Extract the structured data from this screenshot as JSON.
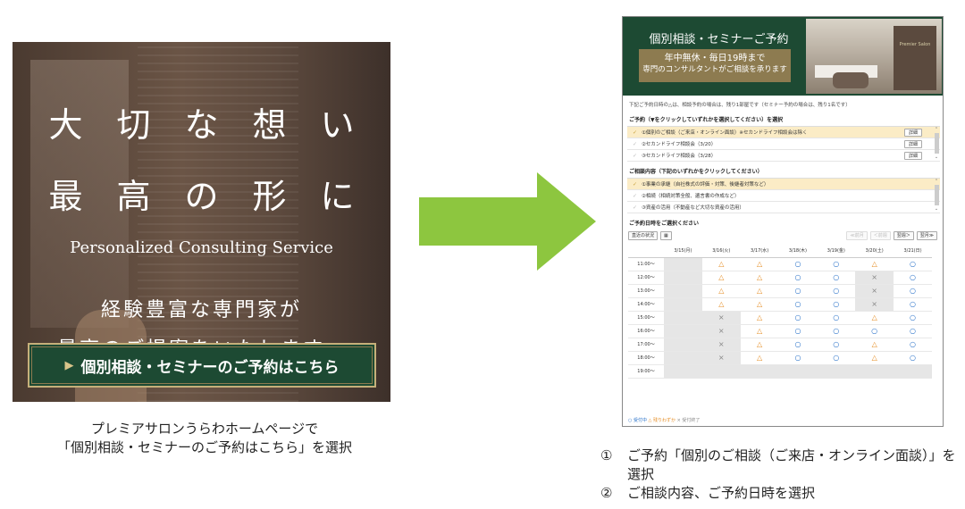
{
  "banner": {
    "headline1": "大切な想い",
    "headline2": "最高の形に",
    "subtitle_en": "Personalized Consulting Service",
    "copy1": "経験豊富な専門家が",
    "copy2": "最高のご提案をいたします。",
    "cta_label": "個別相談・セミナーのご予約はこちら",
    "cta_icon": "play-triangle-icon"
  },
  "caption_left": {
    "line1": "プレミアサロンうらわホームページで",
    "line2": "「個別相談・セミナーのご予約はこちら」を選択"
  },
  "arrow_color": "#8dc63f",
  "reservation": {
    "title": "個別相談・セミナーご予約",
    "badge_line1": "年中無休・毎日19時まで",
    "badge_line2": "専門のコンサルタントがご相談を承ります",
    "photo_sign": "Premier Salon",
    "note": "下記ご予約日時の△は、相談予約の場合は、残り1部屋です（セミナー予約の場合は、残り1名です）",
    "section1_title": "ご予約（▼をクリックしていずれかを選択してください）を選択",
    "section1_items": [
      {
        "label": "①個別のご相談（ご来店・オンライン面談）※セカンドライフ相談会は除く",
        "detail": "詳細",
        "selected": true
      },
      {
        "label": "②セカンドライフ相談会（3/20）",
        "detail": "詳細",
        "selected": false
      },
      {
        "label": "③セカンドライフ相談会（3/28）",
        "detail": "詳細",
        "selected": false
      }
    ],
    "section2_title": "ご相談内容（下記のいずれかをクリックしてください）",
    "section2_items": [
      {
        "label": "①事業の承継（自社株式の評価・対策、後継者対策など）",
        "selected": true
      },
      {
        "label": "②相続（相続対策全般、遺言書の作成など）",
        "selected": false
      },
      {
        "label": "③資産の活用（不動産など大切な資産の活用）",
        "selected": false
      }
    ],
    "section3_title": "ご予約日時をご選択ください",
    "toolbar": {
      "status": "直近の状況",
      "calendar_icon": "calendar-icon",
      "prev_month": "≪前月",
      "prev_week": "＜前週",
      "next_week": "翌週＞",
      "next_month": "翌月≫"
    },
    "calendar": {
      "days": [
        "3/15(月)",
        "3/16(火)",
        "3/17(水)",
        "3/18(木)",
        "3/19(金)",
        "3/20(土)",
        "3/21(日)"
      ],
      "day_colors": [
        "normal",
        "normal",
        "normal",
        "normal",
        "normal",
        "sat",
        "sun"
      ],
      "times": [
        "11:00～",
        "12:00～",
        "13:00～",
        "14:00～",
        "15:00～",
        "16:00～",
        "17:00～",
        "18:00～",
        "19:00～"
      ],
      "cells": [
        [
          "-",
          "△",
          "△",
          "○",
          "○",
          "△",
          "○"
        ],
        [
          "-",
          "△",
          "△",
          "○",
          "○",
          "×",
          "○"
        ],
        [
          "-",
          "△",
          "△",
          "○",
          "○",
          "×",
          "○"
        ],
        [
          "-",
          "△",
          "△",
          "○",
          "○",
          "×",
          "○"
        ],
        [
          "-",
          "×",
          "△",
          "○",
          "○",
          "△",
          "○"
        ],
        [
          "-",
          "×",
          "△",
          "○",
          "○",
          "○",
          "○"
        ],
        [
          "-",
          "×",
          "△",
          "○",
          "○",
          "△",
          "○"
        ],
        [
          "-",
          "×",
          "△",
          "○",
          "○",
          "△",
          "○"
        ],
        [
          "-",
          "-",
          "-",
          "-",
          "-",
          "-",
          "-"
        ]
      ]
    },
    "legend": {
      "open": "○ 受付中",
      "few": "△ 残りわずか",
      "closed": "× 受付終了"
    }
  },
  "caption_right": {
    "item1_num": "①",
    "item1_text": "ご予約「個別のご相談（ご来店・オンライン面談）」を選択",
    "item2_num": "②",
    "item2_text": "ご相談内容、ご予約日時を選択"
  }
}
